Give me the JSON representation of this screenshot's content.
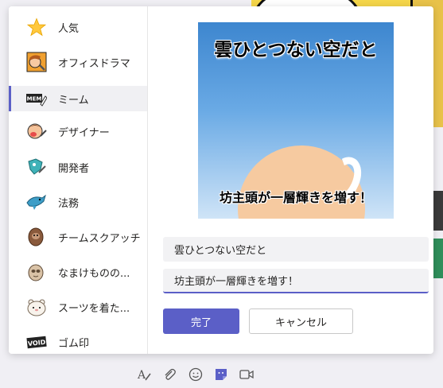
{
  "categories": [
    {
      "label": "人気",
      "icon": "star-icon"
    },
    {
      "label": "オフィスドラマ",
      "icon": "office-drama-icon"
    },
    {
      "label": "ミーム",
      "icon": "meme-icon",
      "active": true
    },
    {
      "label": "デザイナー",
      "icon": "designer-icon"
    },
    {
      "label": "開発者",
      "icon": "developer-icon"
    },
    {
      "label": "法務",
      "icon": "legal-shark-icon"
    },
    {
      "label": "チームスクアッチ",
      "icon": "squatch-icon"
    },
    {
      "label": "なまけものの...",
      "icon": "sloth-icon"
    },
    {
      "label": "スーツを着た...",
      "icon": "bear-in-suit-icon"
    },
    {
      "label": "ゴム印",
      "icon": "rubber-stamp-icon"
    }
  ],
  "preview": {
    "top_text": "雲ひとつない空だと",
    "bottom_text": "坊主頭が一層輝きを増す！"
  },
  "fields": {
    "top_value": "雲ひとつない空だと",
    "bottom_value": "坊主頭が一層輝きを増す！"
  },
  "buttons": {
    "done": "完了",
    "cancel": "キャンセル"
  },
  "toolbar": [
    "format-icon",
    "attach-icon",
    "emoji-icon",
    "sticker-icon",
    "meet-icon"
  ],
  "colors": {
    "accent": "#5b5fc7"
  }
}
